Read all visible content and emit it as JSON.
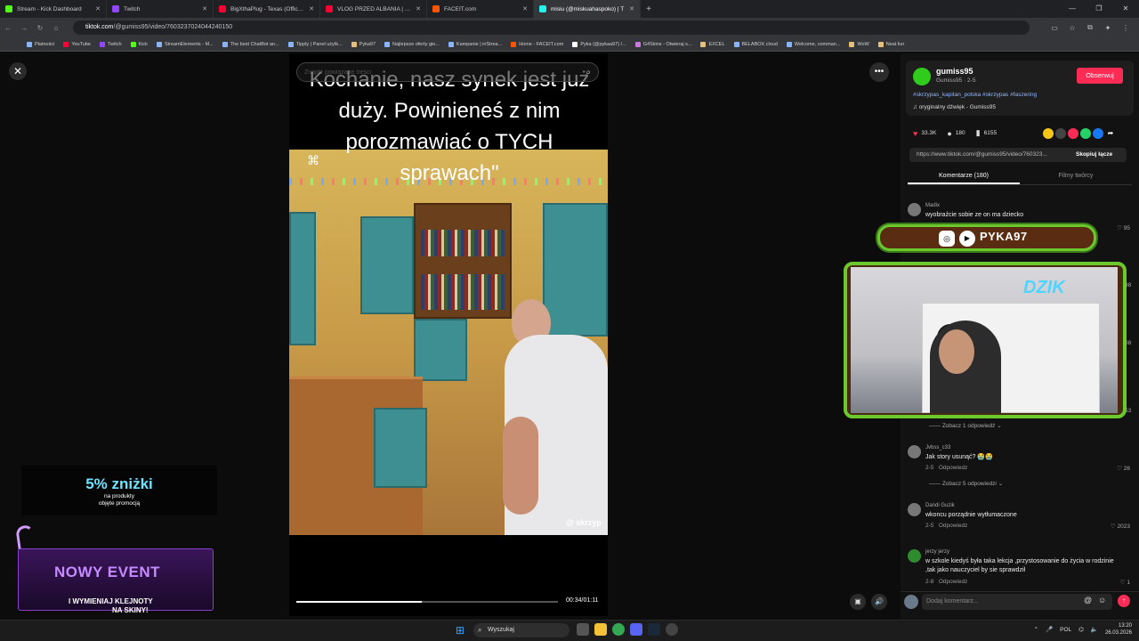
{
  "browser": {
    "tabs": [
      {
        "title": "Stream - Kick Dashboard",
        "color": "#53fc18"
      },
      {
        "title": "Twitch",
        "color": "#9146ff"
      },
      {
        "title": "BigXthaPlug - Texas (Official M",
        "color": "#ff0033"
      },
      {
        "title": "VLOG PRZED ALBANIA | Cały vl",
        "color": "#ff0033"
      },
      {
        "title": "FACEIT.com",
        "color": "#ff5500"
      },
      {
        "title": "misiu (@miskuahaspoko) | T",
        "color": "#25f4ee"
      }
    ],
    "url_domain": "tiktok.com",
    "url_path": "/@gumiss95/video/7603237024044240150",
    "bookmarks": [
      "Płatności",
      "YouTube",
      "Twitch",
      "Kick",
      "StreamElements - M...",
      "The best ChatBot an...",
      "Tipply | Panel użytk...",
      "Pyka97",
      "Najlepsze oferty gie...",
      "Kampanie | inStrea...",
      "Home - FACEIT.com",
      "Pyka (@pykaa97) /...",
      "G4Skins - Otwieraj s...",
      "EXCEL",
      "BELABOX cloud",
      "Welcome, comman...",
      "WoW",
      "Neal.fun"
    ]
  },
  "video": {
    "search_placeholder": "Znajdź powiązane treści",
    "caption": "Kochanie, nasz synek jest już duży. Powinieneś z nim porozmawiać o TYCH sprawach\"",
    "watermark": "@ skrzyp",
    "time": "00:34/01:11",
    "progress": 0.48
  },
  "post": {
    "creator_name": "gumiss95",
    "creator_sub": "Gumiss95 · 2-5",
    "follow_label": "Obserwuj",
    "tags": "#skrzypas_kapitan_polska #skrzypas #faszering",
    "sound": "oryginalny dźwięk - Gumiss95",
    "likes": "33.3K",
    "comments_count": "180",
    "saves": "6155",
    "link": "https://www.tiktok.com/@gumiss95/video/760323...",
    "copy_label": "Skopiuj łącze",
    "tab_comments": "Komentarze (180)",
    "tab_creator": "Filmy twórcy"
  },
  "comments": [
    {
      "name": "Madix",
      "text": "wyobraźcie sobie ze on ma dziecko",
      "likes": "95"
    },
    {
      "name": "Jvbss_c33",
      "text": "Jak story usunąć? 😭😭",
      "date": "2-5",
      "reply": "Odpowiedz",
      "likes": "26"
    },
    {
      "name": "Dandi Guzik",
      "text": "wkoncu porządnie wytłumaczone",
      "date": "2-5",
      "reply": "Odpowiedz",
      "likes": "2023"
    },
    {
      "name": "jerzy jerzy",
      "text": "w szkole kiedyś była taka lekcja ,przystosowanie do życia w rodzinie ,tak jako nauczyciel by sie sprawdził",
      "date": "2-8",
      "reply": "Odpowiedz",
      "likes": "1"
    }
  ],
  "side_counts": [
    "38",
    "08",
    "53"
  ],
  "replies": [
    "Zobacz 1 odpowiedź",
    "Zobacz 5 odpowiedzi"
  ],
  "comment_placeholder": "Dodaj komentarz...",
  "overlays": {
    "handle": "PYKA97",
    "cam_logo": "DZIK",
    "promo_big": "5% zniżki",
    "promo_line1": "na produkty",
    "promo_line2": "objęte promocją",
    "event_title": "NOWY EVENT",
    "event_line1": "I WYMIENIAJ KLEJNOTY",
    "event_line2": "NA SKINY!"
  },
  "taskbar": {
    "search": "Wyszukaj",
    "lang": "POL",
    "time": "13:20",
    "date": "26.03.2026"
  }
}
